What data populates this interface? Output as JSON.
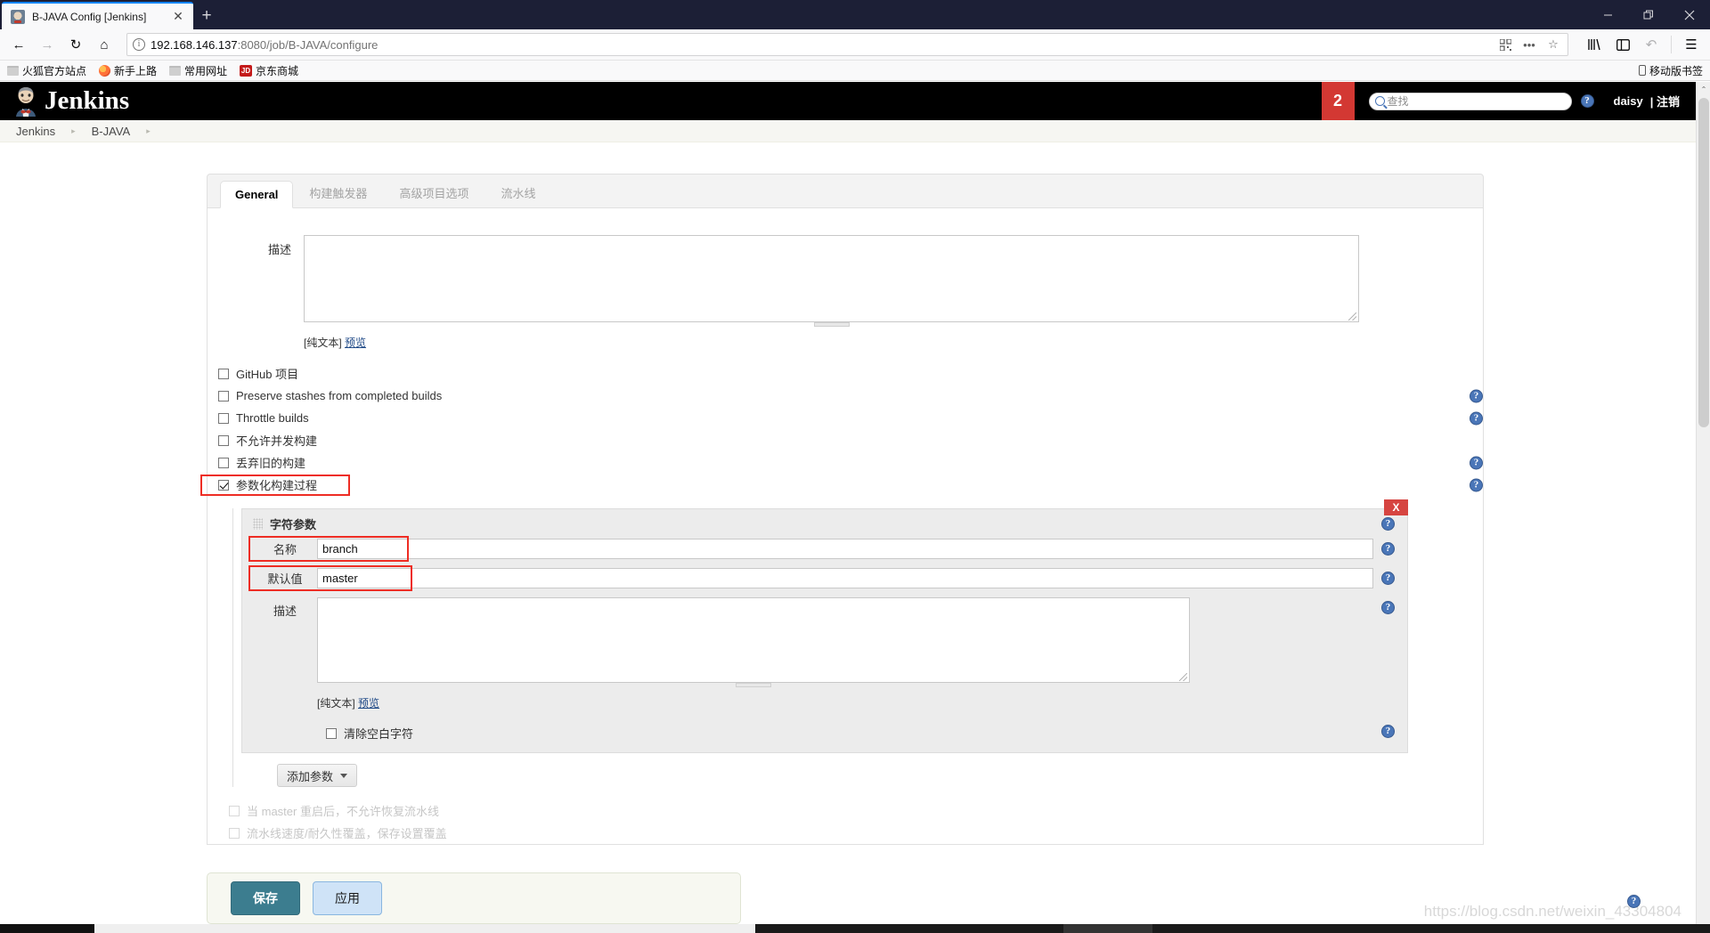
{
  "browser": {
    "tab": {
      "title": "B-JAVA Config [Jenkins]",
      "close_label": "✕",
      "favicon_name": "jenkins-favicon"
    },
    "new_tab_label": "+",
    "window_controls": {
      "minimize": "—",
      "maximize": "❐",
      "close": "✕"
    },
    "nav": {
      "back": "←",
      "forward": "→",
      "reload": "↻",
      "home": "⌂"
    },
    "url": {
      "protocol_info": "i",
      "host": "192.168.146.137",
      "port_path": ":8080/job/B-JAVA/configure"
    },
    "url_icons": {
      "qr": "▒",
      "more": "•••",
      "bookmark_star": "☆"
    },
    "toolbar_right": {
      "library": "library-icon",
      "sidebar": "sidebar-icon",
      "sync": "↶",
      "menu": "☰"
    },
    "bookmarks": [
      {
        "label": "火狐官方站点",
        "icon": "folder-icon"
      },
      {
        "label": "新手上路",
        "icon": "firefox-icon"
      },
      {
        "label": "常用网址",
        "icon": "folder-icon"
      },
      {
        "label": "京东商城",
        "icon": "jd-icon"
      }
    ],
    "bookmarks_right": {
      "label": "移动版书签",
      "icon": "mobile-icon"
    }
  },
  "jenkins": {
    "brand": "Jenkins",
    "notification_count": "2",
    "search_placeholder": "查找",
    "help_glyph": "?",
    "user": "daisy",
    "logout": "| 注销",
    "breadcrumbs": [
      {
        "label": "Jenkins"
      },
      {
        "label": "B-JAVA"
      }
    ],
    "breadcrumb_arrow": "▸"
  },
  "tabs": [
    {
      "label": "General",
      "active": true
    },
    {
      "label": "构建触发器",
      "active": false
    },
    {
      "label": "高级项目选项",
      "active": false
    },
    {
      "label": "流水线",
      "active": false
    }
  ],
  "form": {
    "description_label": "描述",
    "description_value": "",
    "plaintext_label": "[纯文本]",
    "preview_link": "预览",
    "checkboxes": [
      {
        "label": "GitHub 项目",
        "checked": false,
        "help": false
      },
      {
        "label": "Preserve stashes from completed builds",
        "checked": false,
        "help": true
      },
      {
        "label": "Throttle builds",
        "checked": false,
        "help": true
      },
      {
        "label": "不允许并发构建",
        "checked": false,
        "help": false
      },
      {
        "label": "丢弃旧的构建",
        "checked": false,
        "help": true
      },
      {
        "label": "参数化构建过程",
        "checked": true,
        "help": true,
        "highlighted": true
      }
    ]
  },
  "parameter": {
    "title": "字符参数",
    "close_label": "X",
    "name_label": "名称",
    "name_value": "branch",
    "default_label": "默认值",
    "default_value": "master",
    "description_label": "描述",
    "description_value": "",
    "plaintext_label": "[纯文本]",
    "preview_link": "预览",
    "trim_label": "清除空白字符",
    "trim_checked": false
  },
  "add_param_button": "添加参数",
  "faded_options": [
    {
      "label": "当 master 重启后，不允许恢复流水线"
    },
    {
      "label": "流水线速度/耐久性覆盖，保存设置覆盖"
    }
  ],
  "actions": {
    "save": "保存",
    "apply": "应用"
  },
  "watermark": "https://blog.csdn.net/weixin_43304804",
  "colors": {
    "accent_red": "#d33833",
    "header_black": "#000000",
    "highlight_red": "#ee2d24",
    "save_teal": "#3c7d8f",
    "apply_blue": "#cfe3f7",
    "help_blue": "#4a76b8"
  },
  "scroll": {
    "up_arrow": "⌃",
    "down_arrow": "⌄"
  }
}
